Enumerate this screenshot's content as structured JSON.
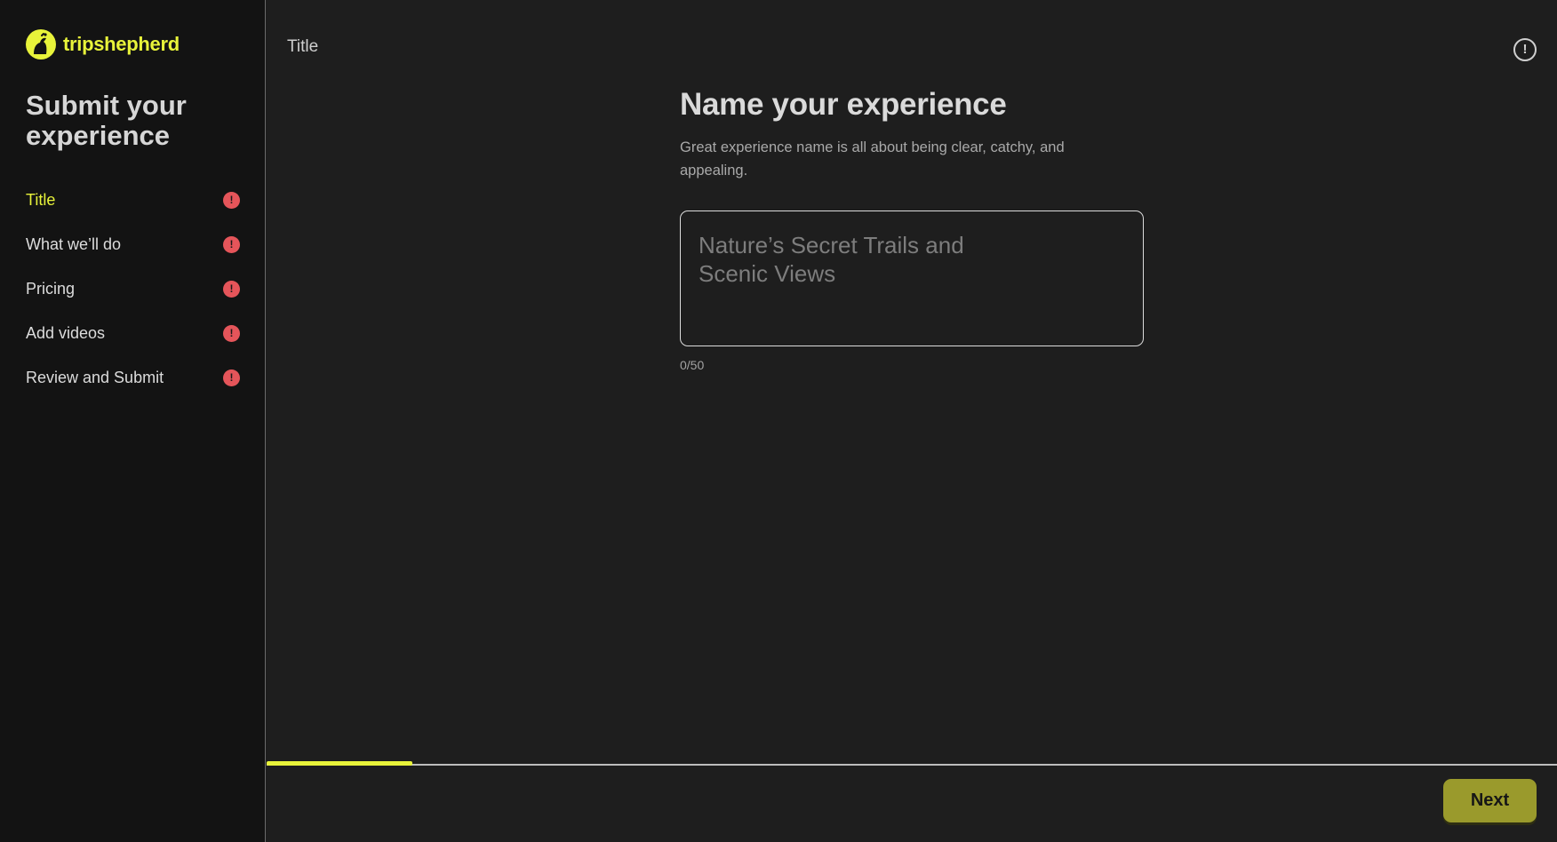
{
  "brand": {
    "name": "tripshepherd",
    "accent": "#e8f33a",
    "logo_icon": "shepherd-logo-icon"
  },
  "sidebar": {
    "title": "Submit your experience",
    "steps": [
      {
        "label": "Title",
        "active": true,
        "status_icon": "alert-icon"
      },
      {
        "label": "What we’ll do",
        "active": false,
        "status_icon": "alert-icon"
      },
      {
        "label": "Pricing",
        "active": false,
        "status_icon": "alert-icon"
      },
      {
        "label": "Add videos",
        "active": false,
        "status_icon": "alert-icon"
      },
      {
        "label": "Review and Submit",
        "active": false,
        "status_icon": "alert-icon"
      }
    ],
    "alert_glyph": "!"
  },
  "header": {
    "title": "Title",
    "info_icon": "info-icon",
    "info_glyph": "!"
  },
  "main": {
    "heading": "Name your experience",
    "subtext": "Great experience name is all about being clear, catchy, and appealing.",
    "name_input": {
      "value": "",
      "placeholder": "Nature’s Secret Trails and\nScenic Views"
    },
    "counter": "0/50"
  },
  "progress": {
    "fraction": 0.113,
    "color": "#e8f33a"
  },
  "footer": {
    "next_label": "Next",
    "next_color": "#9a9a2c"
  },
  "colors": {
    "alert": "#e5555a",
    "background": "#1e1e1e",
    "sidebar": "#131313"
  }
}
